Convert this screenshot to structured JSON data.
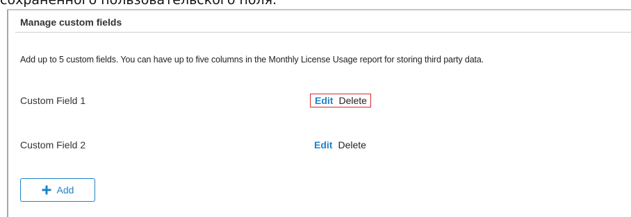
{
  "page_caption": "сохраненного пользовательского поля.",
  "panel": {
    "title": "Manage custom fields",
    "description": "Add up to 5 custom fields. You can have up to five columns in the Monthly License Usage report for storing third party data."
  },
  "fields": [
    {
      "name": "Custom Field 1",
      "edit_label": "Edit",
      "delete_label": "Delete",
      "highlighted": true
    },
    {
      "name": "Custom Field 2",
      "edit_label": "Edit",
      "delete_label": "Delete",
      "highlighted": false
    }
  ],
  "add_button": {
    "label": "Add",
    "icon": "plus-icon"
  },
  "colors": {
    "accent": "#1c83c8",
    "highlight_border": "#d9262c",
    "panel_border": "#a8a8a8"
  }
}
